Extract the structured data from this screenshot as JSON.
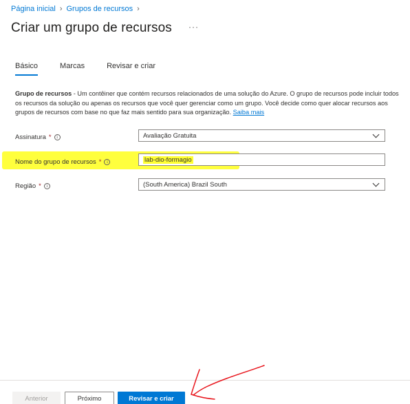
{
  "breadcrumb": {
    "home": "Página inicial",
    "resource_groups": "Grupos de recursos"
  },
  "header": {
    "title": "Criar um grupo de recursos",
    "more": "···"
  },
  "tabs": [
    {
      "label": "Básico",
      "active": true
    },
    {
      "label": "Marcas",
      "active": false
    },
    {
      "label": "Revisar e criar",
      "active": false
    }
  ],
  "description": {
    "bold": "Grupo de recursos",
    "text": " - Um contêiner que contém recursos relacionados de uma solução do Azure. O grupo de recursos pode incluir todos os recursos da solução ou apenas os recursos que você quer gerenciar como um grupo. Você decide como quer alocar recursos aos grupos de recursos com base no que faz mais sentido para sua organização. ",
    "learn_more": "Saiba mais"
  },
  "form": {
    "subscription": {
      "label": "Assinatura",
      "required": "*",
      "value": "Avaliação Gratuita"
    },
    "rg_name": {
      "label": "Nome do grupo de recursos",
      "required": "*",
      "value": "lab-dio-formagio"
    },
    "region": {
      "label": "Região",
      "required": "*",
      "value": "(South America) Brazil South"
    }
  },
  "footer": {
    "previous": "Anterior",
    "next": "Próximo",
    "review_create": "Revisar e criar"
  },
  "colors": {
    "accent": "#0078d4",
    "highlight": "#ffff33",
    "annotation": "#e8141b"
  }
}
